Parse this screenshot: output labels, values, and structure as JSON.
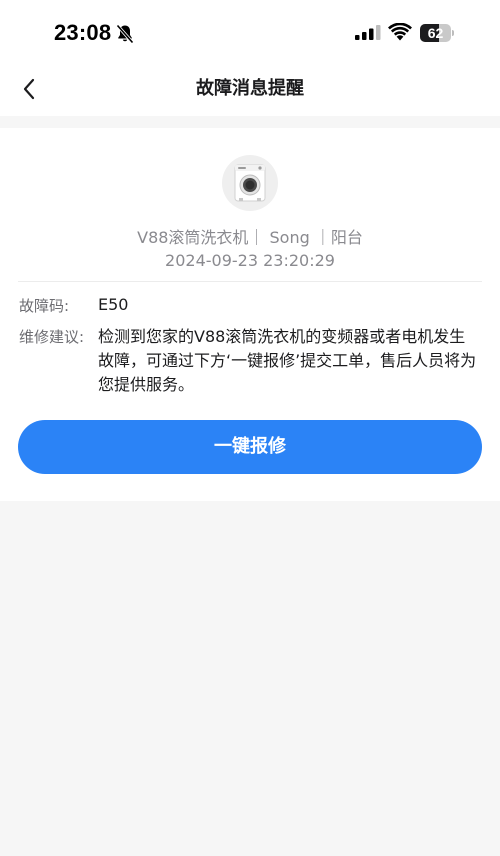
{
  "status_bar": {
    "time": "23:08",
    "battery_level": "62",
    "icons": [
      "bell-off-icon",
      "signal-icon",
      "wifi-icon",
      "battery-icon"
    ]
  },
  "nav": {
    "title": "故障消息提醒",
    "back_icon": "chevron-left-icon"
  },
  "device": {
    "image_icon": "washing-machine-icon",
    "info_line": "V88滚筒洗衣机｜ Song ｜阳台",
    "time": "2024-09-23 23:20:29"
  },
  "fault": {
    "code_label": "故障码:",
    "code_value": "E50",
    "suggestion_label": "维修建议:",
    "suggestion_text": "检测到您家的V88滚筒洗衣机的变频器或者电机发生故障，可通过下方‘一键报修’提交工单，售后人员将为您提供服务。"
  },
  "actions": {
    "repair_label": "一键报修"
  },
  "colors": {
    "accent": "#2b83f6",
    "background": "#f6f6f6",
    "secondary_text": "#8a8a8f"
  }
}
